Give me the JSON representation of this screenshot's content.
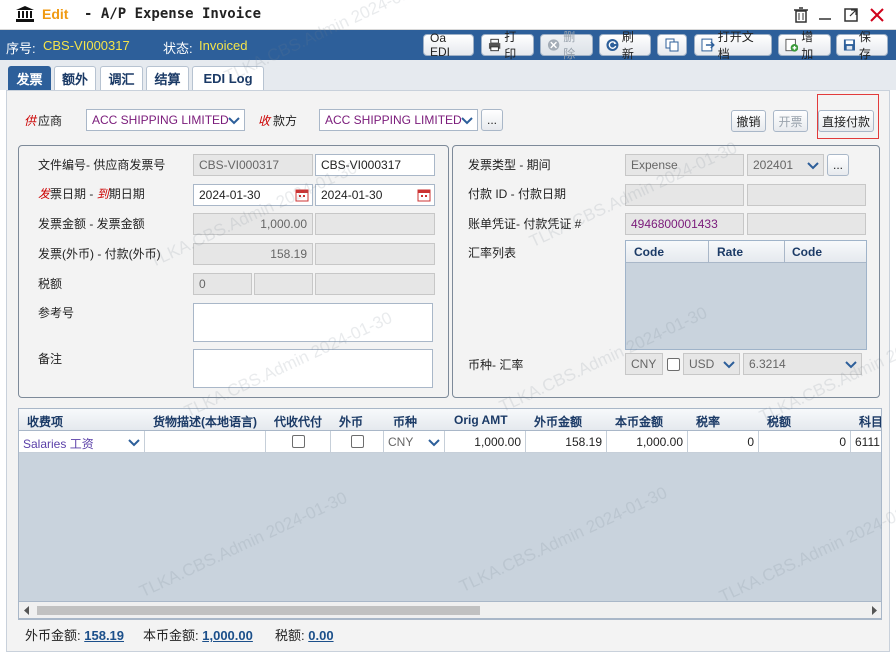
{
  "window": {
    "mode_label": "Edit",
    "title": "- A/P Expense Invoice"
  },
  "header": {
    "serial_label": "序号:",
    "serial_value": "CBS-VI000317",
    "status_label": "状态:",
    "status_value": "Invoiced"
  },
  "toolbar": {
    "oa_edi": "Oa EDI",
    "print": "打印",
    "delete": "删除",
    "refresh": "刷新",
    "open_doc": "打开文档",
    "add": "增加",
    "save": "保存"
  },
  "tabs": [
    "发票",
    "额外",
    "调汇",
    "结算",
    "EDI Log"
  ],
  "parties": {
    "supplier_label_a": "供",
    "supplier_label_b": "应商",
    "supplier_value": "ACC SHIPPING LIMITED",
    "payee_label_a": "收",
    "payee_label_b": "款方",
    "payee_value": "ACC SHIPPING LIMITED",
    "more": "...",
    "cancel": "撤销",
    "open_invoice": "开票",
    "direct_pay": "直接付款"
  },
  "left_form": {
    "doc_no_label": "文件编号- 供应商发票号",
    "doc_no": "CBS-VI000317",
    "supplier_inv_no": "CBS-VI000317",
    "date_label_a": "发",
    "date_label_b": "票日期 -",
    "date_label_c": "到",
    "date_label_d": "期日期",
    "invoice_date": "2024-01-30",
    "due_date": "2024-01-30",
    "amount_label": "发票金额 - 发票金额",
    "amount": "1,000.00",
    "amount2": "",
    "fx_label": "发票(外币) - 付款(外币)",
    "fx_amount": "158.19",
    "fx_paid": "",
    "tax_label": "税额",
    "tax": "0",
    "ref_label": "参考号",
    "ref": "",
    "note_label": "备注",
    "note": ""
  },
  "right_form": {
    "type_label": "发票类型 - 期间",
    "type": "Expense",
    "period": "202401",
    "more": "...",
    "pay_id_label": "付款 ID - 付款日期",
    "pay_id": "",
    "pay_date": "",
    "voucher_label": "账单凭证- 付款凭证 #",
    "voucher": "4946800001433",
    "pay_voucher": "",
    "rate_list_label": "汇率列表",
    "rate_cols": [
      "Code",
      "Rate",
      "Code"
    ],
    "currency_label": "币种- 汇率",
    "currency": "CNY",
    "fx_currency": "USD",
    "fx_rate": "6.3214"
  },
  "grid": {
    "columns": [
      "收费项",
      "货物描述(本地语言)",
      "代收代付",
      "外币",
      "币种",
      "Orig AMT",
      "外币金额",
      "本币金额",
      "税率",
      "税额",
      "科目"
    ],
    "rows": [
      {
        "charge": "Salaries 工资",
        "desc": "",
        "currency": "CNY",
        "orig_amt": "1,000.00",
        "fx_amt": "158.19",
        "local_amt": "1,000.00",
        "tax_rate": "0",
        "tax": "0",
        "account": "6111"
      }
    ]
  },
  "footer": {
    "fx_label": "外币金额:",
    "fx_value": "158.19",
    "local_label": "本币金额:",
    "local_value": "1,000.00",
    "tax_label": "税额:",
    "tax_value": "0.00"
  },
  "watermark": "TLKA.CBS.Admin 2024-01-30"
}
